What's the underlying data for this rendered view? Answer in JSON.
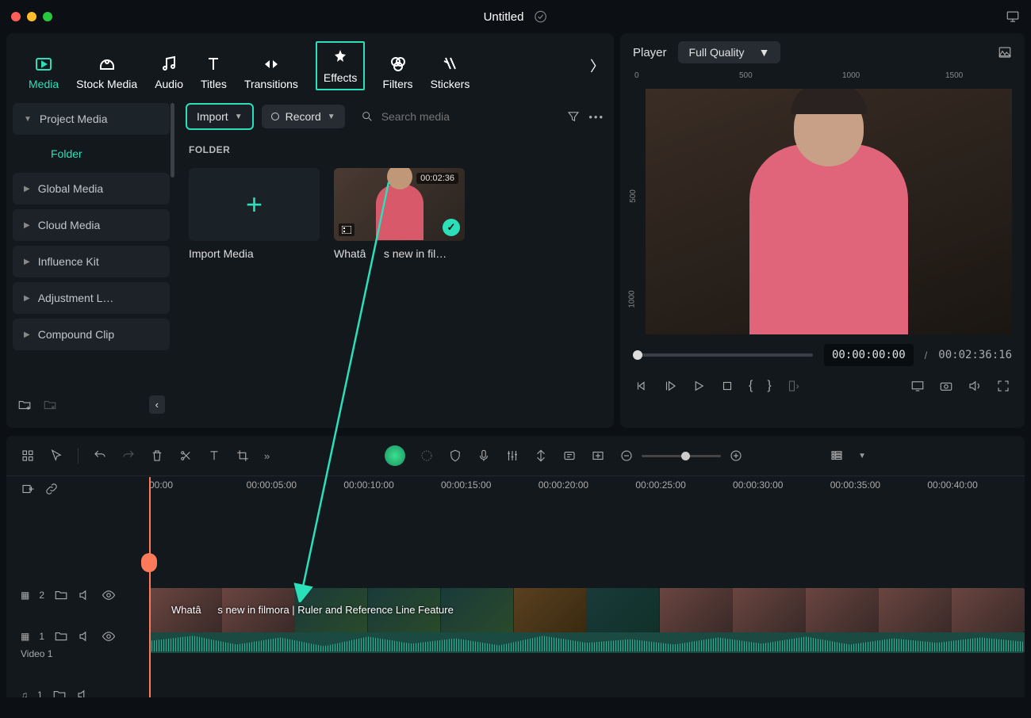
{
  "titlebar": {
    "title": "Untitled"
  },
  "tabs": [
    {
      "id": "media",
      "label": "Media",
      "active": true
    },
    {
      "id": "stock",
      "label": "Stock Media"
    },
    {
      "id": "audio",
      "label": "Audio"
    },
    {
      "id": "titles",
      "label": "Titles"
    },
    {
      "id": "transitions",
      "label": "Transitions"
    },
    {
      "id": "effects",
      "label": "Effects",
      "boxed": true
    },
    {
      "id": "filters",
      "label": "Filters"
    },
    {
      "id": "stickers",
      "label": "Stickers"
    }
  ],
  "sidebar": {
    "items": [
      {
        "label": "Project Media",
        "expanded": true
      },
      {
        "label": "Folder",
        "sub": true
      },
      {
        "label": "Global Media"
      },
      {
        "label": "Cloud Media"
      },
      {
        "label": "Influence Kit"
      },
      {
        "label": "Adjustment L…"
      },
      {
        "label": "Compound Clip"
      }
    ]
  },
  "toolbar": {
    "import": "Import",
    "record": "Record",
    "search_placeholder": "Search media"
  },
  "folder": {
    "heading": "FOLDER",
    "cards": [
      {
        "label": "Import Media",
        "type": "add"
      },
      {
        "label": "Whatâs new in fil…",
        "type": "video",
        "duration": "00:02:36"
      }
    ]
  },
  "player": {
    "title": "Player",
    "quality": "Full Quality",
    "ruler": [
      "0",
      "500",
      "1000",
      "1500"
    ],
    "vruler": [
      "500",
      "1000"
    ],
    "current": "00:00:00:00",
    "sep": "/",
    "total": "00:02:36:16"
  },
  "timeline": {
    "marks": [
      "00:00",
      "00:00:05:00",
      "00:00:10:00",
      "00:00:15:00",
      "00:00:20:00",
      "00:00:25:00",
      "00:00:30:00",
      "00:00:35:00",
      "00:00:40:00"
    ],
    "clip_title": "Whatâs new in filmora | Ruler and Reference Line Feature",
    "video_track_label": "Video 1",
    "track_counts": {
      "t1": "2",
      "t2": "1",
      "t3": "1"
    }
  }
}
